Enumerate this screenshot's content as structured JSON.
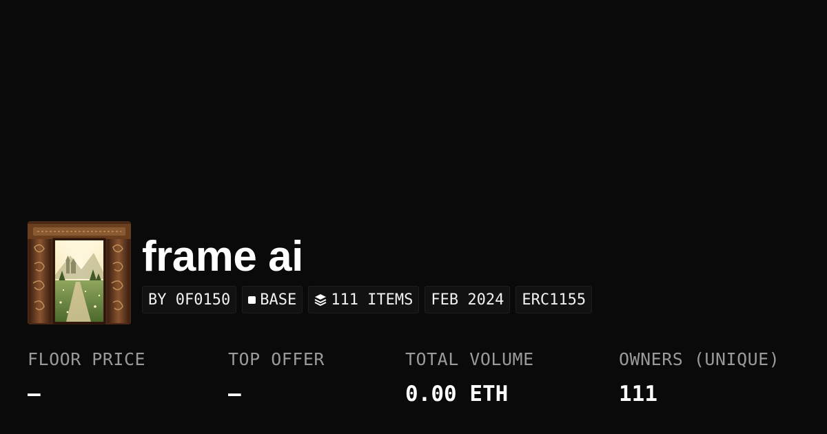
{
  "collection": {
    "name": "frame ai",
    "thumbnail_icon": "portal-door-image"
  },
  "chips": {
    "creator": "BY 0F0150",
    "chain": "BASE",
    "chain_icon": "square-chain-icon",
    "items": "111 ITEMS",
    "items_icon": "layers-icon",
    "date": "FEB 2024",
    "standard": "ERC1155"
  },
  "stats": {
    "floor_price": {
      "label": "FLOOR PRICE",
      "value": "–"
    },
    "top_offer": {
      "label": "TOP OFFER",
      "value": "–"
    },
    "total_volume": {
      "label": "TOTAL VOLUME",
      "value": "0.00 ETH"
    },
    "owners": {
      "label": "OWNERS (UNIQUE)",
      "value": "111"
    }
  },
  "colors": {
    "background": "#0a0a0a",
    "text": "#ffffff",
    "muted": "#9a9a9a",
    "chip_bg": "#121212"
  }
}
